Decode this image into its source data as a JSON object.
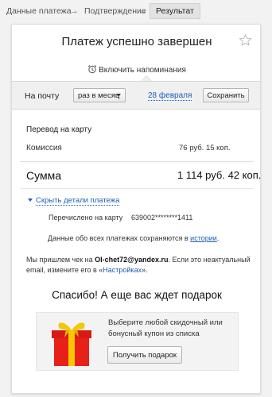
{
  "breadcrumbs": {
    "step1": "Данные платежа",
    "step2": "Подтверждение",
    "step3": "Результат",
    "arrow": "→"
  },
  "header": {
    "title": "Платеж успешно завершен",
    "favorite_icon": "star-outline-icon"
  },
  "reminder": {
    "label": "Включить напоминания",
    "icon": "alarm-clock-icon"
  },
  "reminder_settings": {
    "channel_label": "На почту",
    "frequency_value": "раз в месяц",
    "date_link": "28 февраля",
    "save_label": "Сохранить"
  },
  "payment": {
    "section_title": "Перевод на карту",
    "fee_label": "Комиссия",
    "fee_value": "76 руб. 15 коп.",
    "total_label": "Сумма",
    "total_value": "1 114 руб. 42 коп."
  },
  "details": {
    "toggle_label": "Скрыть детали платежа",
    "sent_label": "Перечислено на карту",
    "card_number": "639002********1411",
    "history_text": "Данные обо всех платежах сохраняются в",
    "history_link": "истории",
    "history_end": "."
  },
  "receipt": {
    "text_before": "Мы пришлем чек на",
    "email": "Ol-chet72@yandex.ru",
    "text_middle": ". Если это неактуальный email, измените его в «",
    "settings_link": "Настройках",
    "text_end": "»."
  },
  "gift": {
    "title": "Спасибо! А еще вас ждет подарок",
    "description": "Выберите любой скидочный или бонусный купон из списка",
    "button_label": "Получить подарок",
    "icon": "gift-box-icon",
    "colors": {
      "box": "#e8201a",
      "ribbon": "#f5c800"
    }
  },
  "colors": {
    "link": "#1a5fb4",
    "band_bg": "#f0f0f0",
    "page_bg": "#f2f2f2"
  }
}
